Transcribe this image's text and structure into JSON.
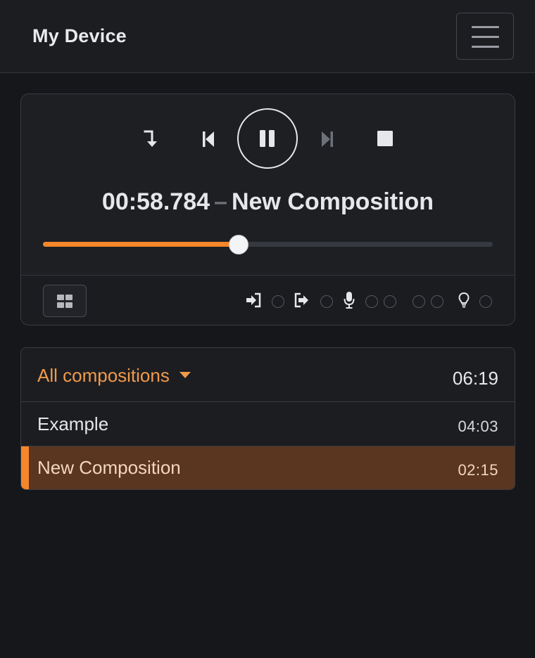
{
  "navbar": {
    "title": "My Device",
    "menu_icon": "hamburger-icon"
  },
  "player": {
    "controls": [
      {
        "name": "jump-to-marker",
        "icon": "arrow-down-turn-icon"
      },
      {
        "name": "skip-back",
        "icon": "skip-back-icon"
      },
      {
        "name": "pause",
        "icon": "pause-icon"
      },
      {
        "name": "skip-forward",
        "icon": "skip-forward-icon",
        "disabled": true
      },
      {
        "name": "stop",
        "icon": "stop-icon"
      }
    ],
    "time": "00:58.784",
    "separator": "–",
    "composition": "New Composition",
    "progress_fraction": 0.435,
    "accent_color": "#f5862a",
    "status_icons": [
      "sign-in-icon",
      "sign-out-icon",
      "microphone-icon",
      "lightbulb-icon"
    ]
  },
  "compositions": {
    "filter_label": "All compositions",
    "total": "06:19",
    "items": [
      {
        "name": "Example",
        "duration": "04:03",
        "active": false
      },
      {
        "name": "New Composition",
        "duration": "02:15",
        "active": true
      }
    ]
  }
}
